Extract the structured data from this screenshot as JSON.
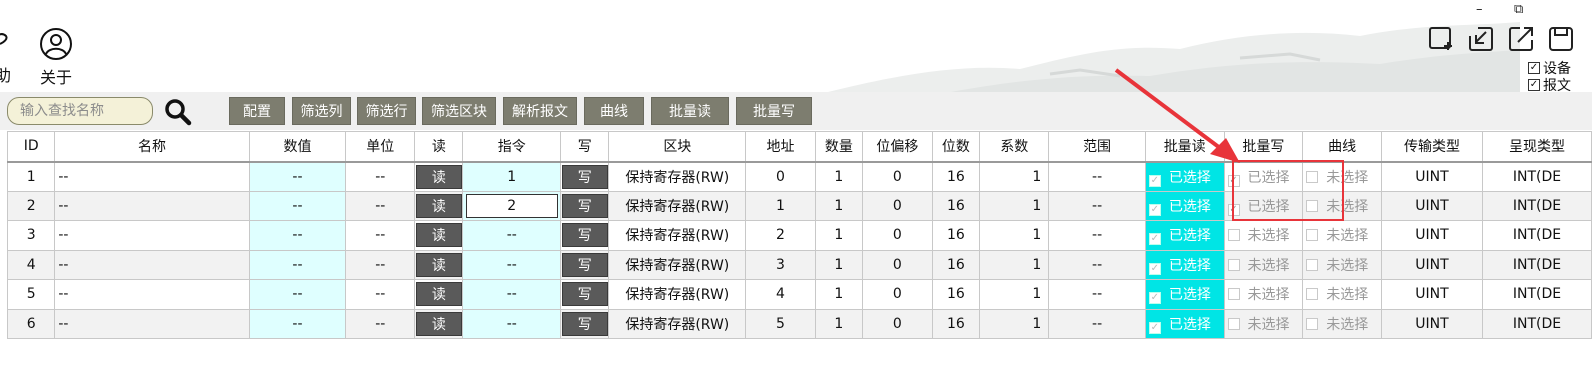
{
  "header": {
    "help_label": "助",
    "about_label": "关于",
    "window_controls": {
      "minimize": "–",
      "restore": "⧉"
    },
    "icons": [
      "add-window-icon",
      "collapse-icon",
      "export-icon",
      "save-icon"
    ],
    "checkboxes": [
      {
        "label": "设备",
        "checked": true
      },
      {
        "label": "报文",
        "checked": true
      }
    ]
  },
  "toolbar": {
    "search_placeholder": "输入查找名称",
    "buttons": [
      "配置",
      "筛选列",
      "筛选行",
      "筛选区块",
      "解析报文",
      "曲线",
      "批量读",
      "批量写"
    ]
  },
  "table": {
    "columns": [
      "ID",
      "名称",
      "数值",
      "单位",
      "读",
      "指令",
      "写",
      "区块",
      "地址",
      "数量",
      "位偏移",
      "位数",
      "系数",
      "范围",
      "批量读",
      "批量写",
      "曲线",
      "传输类型",
      "呈现类型"
    ],
    "read_button": "读",
    "write_button": "写",
    "rows": [
      {
        "id": "1",
        "name": "--",
        "value": "--",
        "unit": "--",
        "cmd": "1",
        "block": "保持寄存器(RW)",
        "addr": "0",
        "count": "1",
        "bitoff": "0",
        "bits": "16",
        "coef": "1",
        "range": "--",
        "batch_read": "已选择",
        "batch_write": "已选择",
        "batch_write_checked": true,
        "curve": "未选择",
        "trans": "UINT",
        "present": "INT(DE"
      },
      {
        "id": "2",
        "name": "--",
        "value": "--",
        "unit": "--",
        "cmd": "2",
        "block": "保持寄存器(RW)",
        "addr": "1",
        "count": "1",
        "bitoff": "0",
        "bits": "16",
        "coef": "1",
        "range": "--",
        "batch_read": "已选择",
        "batch_write": "已选择",
        "batch_write_checked": true,
        "curve": "未选择",
        "trans": "UINT",
        "present": "INT(DE"
      },
      {
        "id": "3",
        "name": "--",
        "value": "--",
        "unit": "--",
        "cmd": "--",
        "block": "保持寄存器(RW)",
        "addr": "2",
        "count": "1",
        "bitoff": "0",
        "bits": "16",
        "coef": "1",
        "range": "--",
        "batch_read": "已选择",
        "batch_write": "未选择",
        "batch_write_checked": false,
        "curve": "未选择",
        "trans": "UINT",
        "present": "INT(DE"
      },
      {
        "id": "4",
        "name": "--",
        "value": "--",
        "unit": "--",
        "cmd": "--",
        "block": "保持寄存器(RW)",
        "addr": "3",
        "count": "1",
        "bitoff": "0",
        "bits": "16",
        "coef": "1",
        "range": "--",
        "batch_read": "已选择",
        "batch_write": "未选择",
        "batch_write_checked": false,
        "curve": "未选择",
        "trans": "UINT",
        "present": "INT(DE"
      },
      {
        "id": "5",
        "name": "--",
        "value": "--",
        "unit": "--",
        "cmd": "--",
        "block": "保持寄存器(RW)",
        "addr": "4",
        "count": "1",
        "bitoff": "0",
        "bits": "16",
        "coef": "1",
        "range": "--",
        "batch_read": "已选择",
        "batch_write": "未选择",
        "batch_write_checked": false,
        "curve": "未选择",
        "trans": "UINT",
        "present": "INT(DE"
      },
      {
        "id": "6",
        "name": "--",
        "value": "--",
        "unit": "--",
        "cmd": "--",
        "block": "保持寄存器(RW)",
        "addr": "5",
        "count": "1",
        "bitoff": "0",
        "bits": "16",
        "coef": "1",
        "range": "--",
        "batch_read": "已选择",
        "batch_write": "未选择",
        "batch_write_checked": false,
        "curve": "未选择",
        "trans": "UINT",
        "present": "INT(DE"
      }
    ]
  },
  "colors": {
    "toolbar_button": "#7d7d6f",
    "value_cell": "#dfffff",
    "batch_read_cell": "#00e5e5",
    "annotation": "#e8343a"
  }
}
